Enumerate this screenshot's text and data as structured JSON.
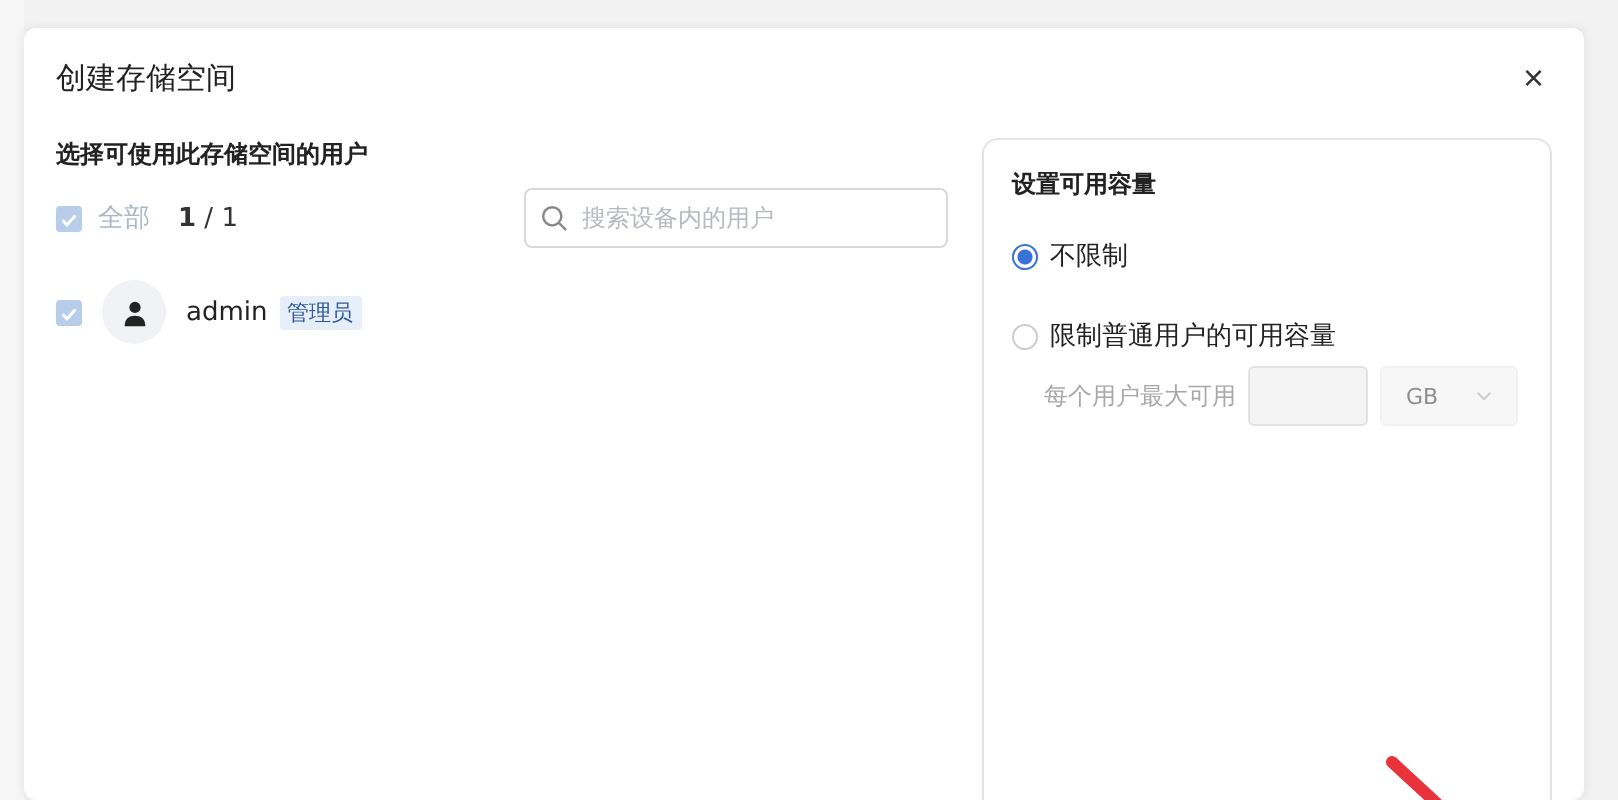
{
  "dialog": {
    "title": "创建存储空间",
    "close": "×"
  },
  "users": {
    "heading": "选择可使用此存储空间的用户",
    "select_all": {
      "label": "全部",
      "checked": true,
      "count": "**1** / 1"
    },
    "search": {
      "placeholder": "搜索设备内的用户"
    },
    "items": [
      {
        "name": "admin",
        "role": "管理员",
        "checked": true
      }
    ]
  },
  "capacity": {
    "heading": "设置可用容量",
    "options": [
      {
        "label": "不限制",
        "selected": true
      },
      {
        "label": "限制普通用户的可用容量",
        "selected": false
      }
    ],
    "limit": {
      "label": "每个用户最大可用",
      "unit": "GB",
      "disabled": true
    }
  }
}
